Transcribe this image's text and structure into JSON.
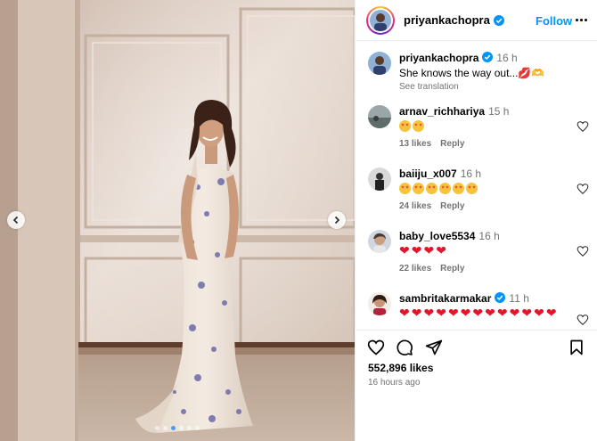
{
  "post": {
    "username": "priyankachopra",
    "follow_label": "Follow",
    "likes": "552,896 likes",
    "posted_ago": "16 hours ago",
    "carousel": {
      "slides": 6,
      "active_index": 2
    }
  },
  "caption": {
    "username": "priyankachopra",
    "time": "16 h",
    "text": "She knows the way out...💋🫶",
    "see_translation": "See translation"
  },
  "comments": [
    {
      "username": "arnav_richhariya",
      "time": "15 h",
      "emoji_count": 2,
      "emoji": "star-struck",
      "likes": "13 likes",
      "reply": "Reply"
    },
    {
      "username": "baiiju_x007",
      "time": "16 h",
      "emoji_count": 6,
      "emoji": "star-struck",
      "likes": "24 likes",
      "reply": "Reply"
    },
    {
      "username": "baby_love5534",
      "time": "16 h",
      "emoji_count": 4,
      "emoji": "red-heart",
      "likes": "22 likes",
      "reply": "Reply"
    },
    {
      "username": "sambritakarmakar",
      "time": "11 h",
      "emoji_count": 13,
      "emoji": "red-heart",
      "verified": true
    }
  ],
  "colors": {
    "accent": "#0095f6",
    "muted": "#737373",
    "heart": "#e0162b",
    "verified": "#0095f6"
  },
  "icons": [
    "chevron-left-icon",
    "chevron-right-icon",
    "more-icon",
    "verified-icon",
    "heart-icon",
    "comment-icon",
    "share-icon",
    "bookmark-icon"
  ]
}
